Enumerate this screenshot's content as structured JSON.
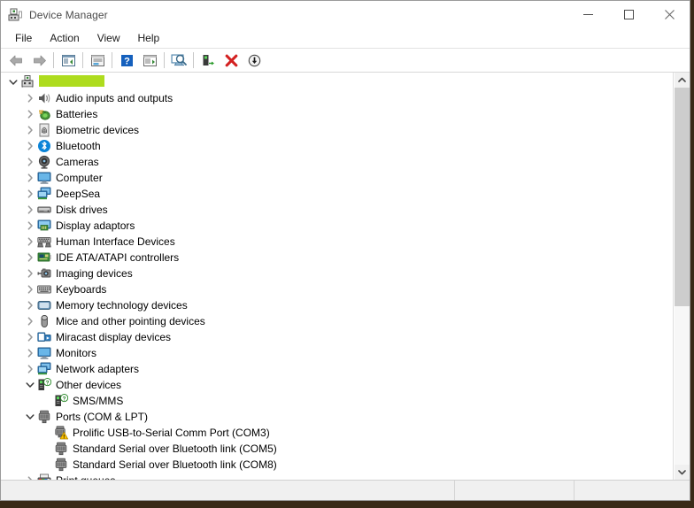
{
  "window": {
    "title": "Device Manager",
    "title_icon": "device-manager-icon",
    "minimize_label": "Minimize",
    "maximize_label": "Maximize",
    "close_label": "Close"
  },
  "menubar": {
    "items": [
      {
        "label": "File",
        "name": "menu-file"
      },
      {
        "label": "Action",
        "name": "menu-action"
      },
      {
        "label": "View",
        "name": "menu-view"
      },
      {
        "label": "Help",
        "name": "menu-help"
      }
    ]
  },
  "toolbar": {
    "buttons": [
      {
        "icon": "back-arrow-icon",
        "title": "Back"
      },
      {
        "icon": "forward-arrow-icon",
        "title": "Forward"
      },
      {
        "icon": "show-hide-console-tree-icon",
        "title": "Show/Hide Console Tree"
      },
      {
        "icon": "properties-icon",
        "title": "Properties"
      },
      {
        "icon": "help-icon",
        "title": "Help"
      },
      {
        "icon": "update-driver-icon",
        "title": "Update Driver"
      },
      {
        "icon": "scan-for-hardware-changes-icon",
        "title": "Scan for hardware changes"
      },
      {
        "icon": "enable-device-icon",
        "title": "Enable device"
      },
      {
        "icon": "uninstall-device-icon",
        "title": "Uninstall device"
      },
      {
        "icon": "download-icon",
        "title": "Download"
      }
    ]
  },
  "tree": {
    "nodes": [
      {
        "label": "",
        "redacted": true,
        "icon": "computer-root-icon",
        "indent": 0,
        "state": "expanded",
        "name": "tree-root-computer"
      },
      {
        "label": "Audio inputs and outputs",
        "icon": "speaker-icon",
        "indent": 1,
        "state": "collapsed",
        "name": "tree-item-audio-inputs-and-outputs"
      },
      {
        "label": "Batteries",
        "icon": "battery-icon",
        "indent": 1,
        "state": "collapsed",
        "name": "tree-item-batteries"
      },
      {
        "label": "Biometric devices",
        "icon": "fingerprint-icon",
        "indent": 1,
        "state": "collapsed",
        "name": "tree-item-biometric-devices"
      },
      {
        "label": "Bluetooth",
        "icon": "bluetooth-icon",
        "indent": 1,
        "state": "collapsed",
        "name": "tree-item-bluetooth"
      },
      {
        "label": "Cameras",
        "icon": "camera-icon",
        "indent": 1,
        "state": "collapsed",
        "name": "tree-item-cameras"
      },
      {
        "label": "Computer",
        "icon": "monitor-icon",
        "indent": 1,
        "state": "collapsed",
        "name": "tree-item-computer"
      },
      {
        "label": "DeepSea",
        "icon": "network-icon",
        "indent": 1,
        "state": "collapsed",
        "name": "tree-item-deepsea"
      },
      {
        "label": "Disk drives",
        "icon": "disk-drive-icon",
        "indent": 1,
        "state": "collapsed",
        "name": "tree-item-disk-drives"
      },
      {
        "label": "Display adaptors",
        "icon": "display-adapter-icon",
        "indent": 1,
        "state": "collapsed",
        "name": "tree-item-display-adaptors"
      },
      {
        "label": "Human Interface Devices",
        "icon": "hid-icon",
        "indent": 1,
        "state": "collapsed",
        "name": "tree-item-human-interface-devices"
      },
      {
        "label": "IDE ATA/ATAPI controllers",
        "icon": "ide-controller-icon",
        "indent": 1,
        "state": "collapsed",
        "name": "tree-item-ide-ata-atapi-controllers"
      },
      {
        "label": "Imaging devices",
        "icon": "imaging-device-icon",
        "indent": 1,
        "state": "collapsed",
        "name": "tree-item-imaging-devices"
      },
      {
        "label": "Keyboards",
        "icon": "keyboard-icon",
        "indent": 1,
        "state": "collapsed",
        "name": "tree-item-keyboards"
      },
      {
        "label": "Memory technology devices",
        "icon": "memory-icon",
        "indent": 1,
        "state": "collapsed",
        "name": "tree-item-memory-technology-devices"
      },
      {
        "label": "Mice and other pointing devices",
        "icon": "mouse-icon",
        "indent": 1,
        "state": "collapsed",
        "name": "tree-item-mice-and-other-pointing-devices"
      },
      {
        "label": "Miracast display devices",
        "icon": "miracast-icon",
        "indent": 1,
        "state": "collapsed",
        "name": "tree-item-miracast-display-devices"
      },
      {
        "label": "Monitors",
        "icon": "monitor-icon",
        "indent": 1,
        "state": "collapsed",
        "name": "tree-item-monitors"
      },
      {
        "label": "Network adapters",
        "icon": "network-icon",
        "indent": 1,
        "state": "collapsed",
        "name": "tree-item-network-adapters"
      },
      {
        "label": "Other devices",
        "icon": "unknown-device-icon",
        "indent": 1,
        "state": "expanded",
        "name": "tree-item-other-devices"
      },
      {
        "label": "SMS/MMS",
        "icon": "unknown-device-icon",
        "indent": 2,
        "state": "leaf",
        "name": "tree-item-sms-mms"
      },
      {
        "label": "Ports (COM & LPT)",
        "icon": "port-icon",
        "indent": 1,
        "state": "expanded",
        "name": "tree-item-ports-com-and-lpt"
      },
      {
        "label": "Prolific USB-to-Serial Comm Port (COM3)",
        "icon": "port-warning-icon",
        "indent": 2,
        "state": "leaf",
        "name": "tree-item-prolific-usb-to-serial-comm-port-com3"
      },
      {
        "label": "Standard Serial over Bluetooth link (COM5)",
        "icon": "port-icon",
        "indent": 2,
        "state": "leaf",
        "name": "tree-item-standard-serial-over-bluetooth-link-com5"
      },
      {
        "label": "Standard Serial over Bluetooth link (COM8)",
        "icon": "port-icon",
        "indent": 2,
        "state": "leaf",
        "name": "tree-item-standard-serial-over-bluetooth-link-com8"
      },
      {
        "label": "Print queues",
        "icon": "printer-icon",
        "indent": 1,
        "state": "collapsed",
        "name": "tree-item-print-queues"
      }
    ]
  },
  "scrollbar": {
    "up_icon": "chevron-up-icon",
    "down_icon": "chevron-down-icon",
    "thumb_position_percent": 0,
    "thumb_size_percent": 58
  },
  "statusbar": {
    "main_text": "",
    "pane_a_text": "",
    "pane_b_text": ""
  },
  "colors": {
    "redaction": "#aedc1e",
    "warning": "#ffc400",
    "uninstall": "#d32020",
    "bluetooth": "#0a84d8",
    "accent": "#1f7fd4"
  }
}
